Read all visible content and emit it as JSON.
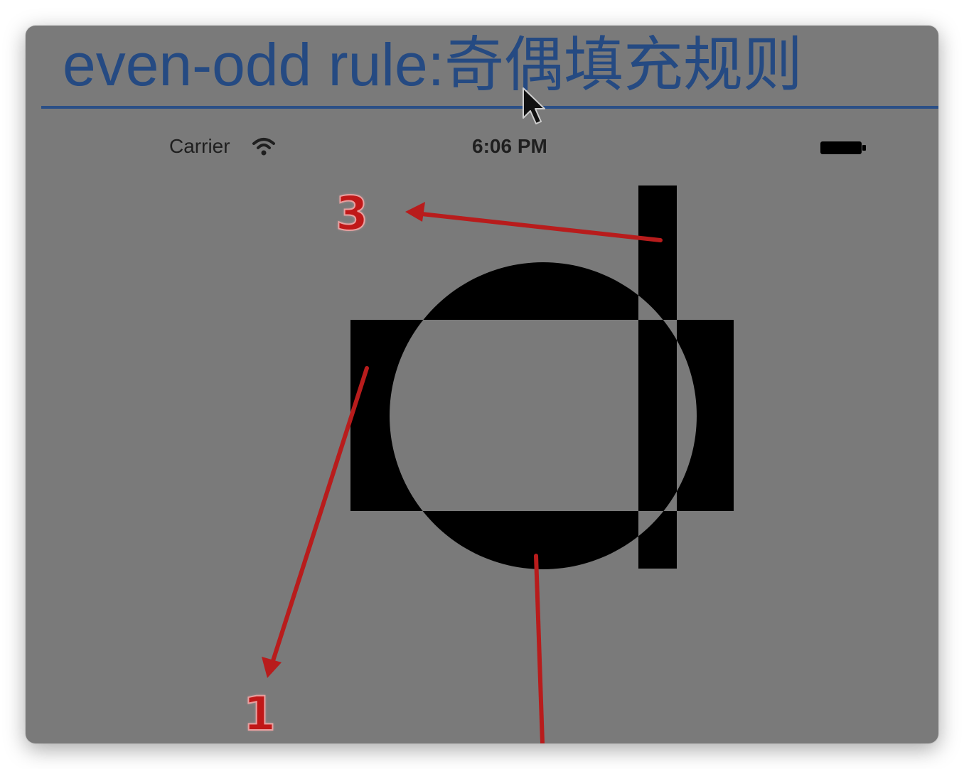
{
  "slide": {
    "title": "even-odd rule:奇偶填充规则"
  },
  "status_bar": {
    "carrier": "Carrier",
    "time": "6:06 PM"
  },
  "annotations": {
    "label_3": "3",
    "label_1": "1"
  },
  "colors": {
    "title": "#254a82",
    "background": "#7a7a7a",
    "fill": "#000000",
    "arrow": "#b81c1c"
  },
  "icons": [
    "cursor-icon",
    "wifi-icon",
    "battery-icon"
  ]
}
